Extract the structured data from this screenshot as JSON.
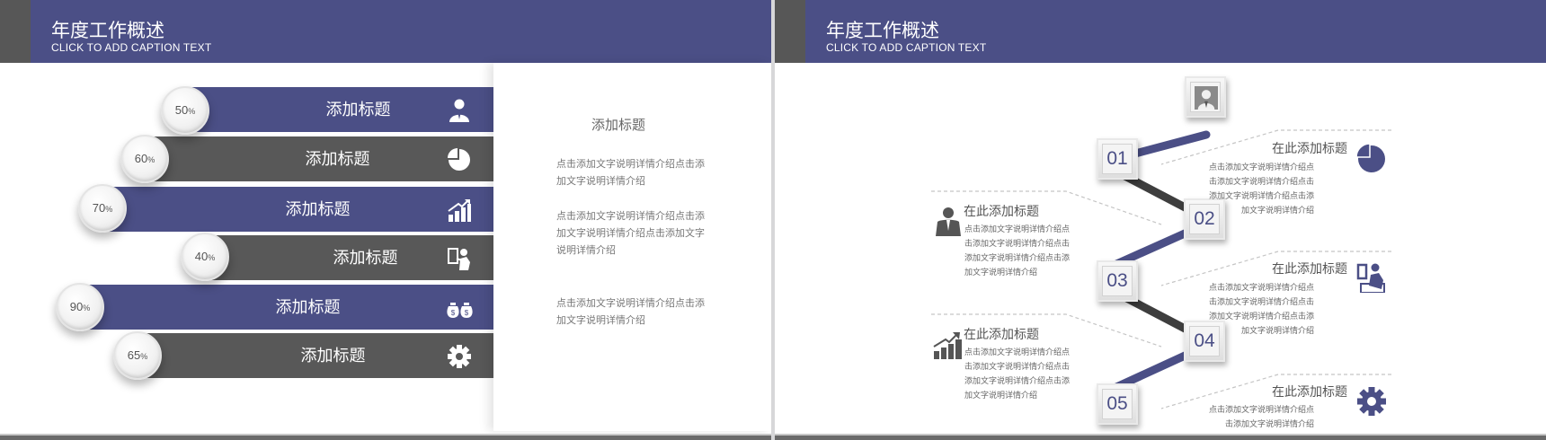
{
  "left": {
    "title": "年度工作概述",
    "caption": "CLICK TO ADD CAPTION TEXT",
    "items": [
      {
        "percent": "50",
        "unit": "%",
        "label": "添加标题",
        "icon": "person-icon"
      },
      {
        "percent": "60",
        "unit": "%",
        "label": "添加标题",
        "icon": "pie-chart-icon"
      },
      {
        "percent": "70",
        "unit": "%",
        "label": "添加标题",
        "icon": "growth-chart-icon"
      },
      {
        "percent": "40",
        "unit": "%",
        "label": "添加标题",
        "icon": "presenter-icon"
      },
      {
        "percent": "90",
        "unit": "%",
        "label": "添加标题",
        "icon": "money-bags-icon"
      },
      {
        "percent": "65",
        "unit": "%",
        "label": "添加标题",
        "icon": "gear-icon"
      }
    ],
    "side": {
      "title": "添加标题",
      "paragraphs": [
        "点击添加文字说明详情介绍点击添加文字说明详情介绍",
        "点击添加文字说明详情介绍点击添加文字说明详情介绍点击添加文字说明详情介绍",
        "点击添加文字说明详情介绍点击添加文字说明详情介绍"
      ]
    }
  },
  "right": {
    "title": "年度工作概述",
    "caption": "CLICK TO ADD CAPTION TEXT",
    "steps": [
      "01",
      "02",
      "03",
      "04",
      "05"
    ],
    "items": [
      {
        "title": "在此添加标题",
        "text": "点击添加文字说明详情介绍点击添加文字说明详情介绍点击添加文字说明详情介绍点击添加文字说明详情介绍",
        "icon": "pie-chart-icon"
      },
      {
        "title": "在此添加标题",
        "text": "点击添加文字说明详情介绍点击添加文字说明详情介绍点击添加文字说明详情介绍点击添加文字说明详情介绍",
        "icon": "businessman-icon"
      },
      {
        "title": "在此添加标题",
        "text": "点击添加文字说明详情介绍点击添加文字说明详情介绍点击添加文字说明详情介绍点击添加文字说明详情介绍",
        "icon": "presenter-icon"
      },
      {
        "title": "在此添加标题",
        "text": "点击添加文字说明详情介绍点击添加文字说明详情介绍点击添加文字说明详情介绍点击添加文字说明详情介绍",
        "icon": "growth-chart-icon"
      },
      {
        "title": "在此添加标题",
        "text": "点击添加文字说明详情介绍点击添加文字说明详情介绍",
        "icon": "gear-icon"
      }
    ]
  },
  "colors": {
    "navy": "#4b4f86",
    "gray": "#585858"
  }
}
